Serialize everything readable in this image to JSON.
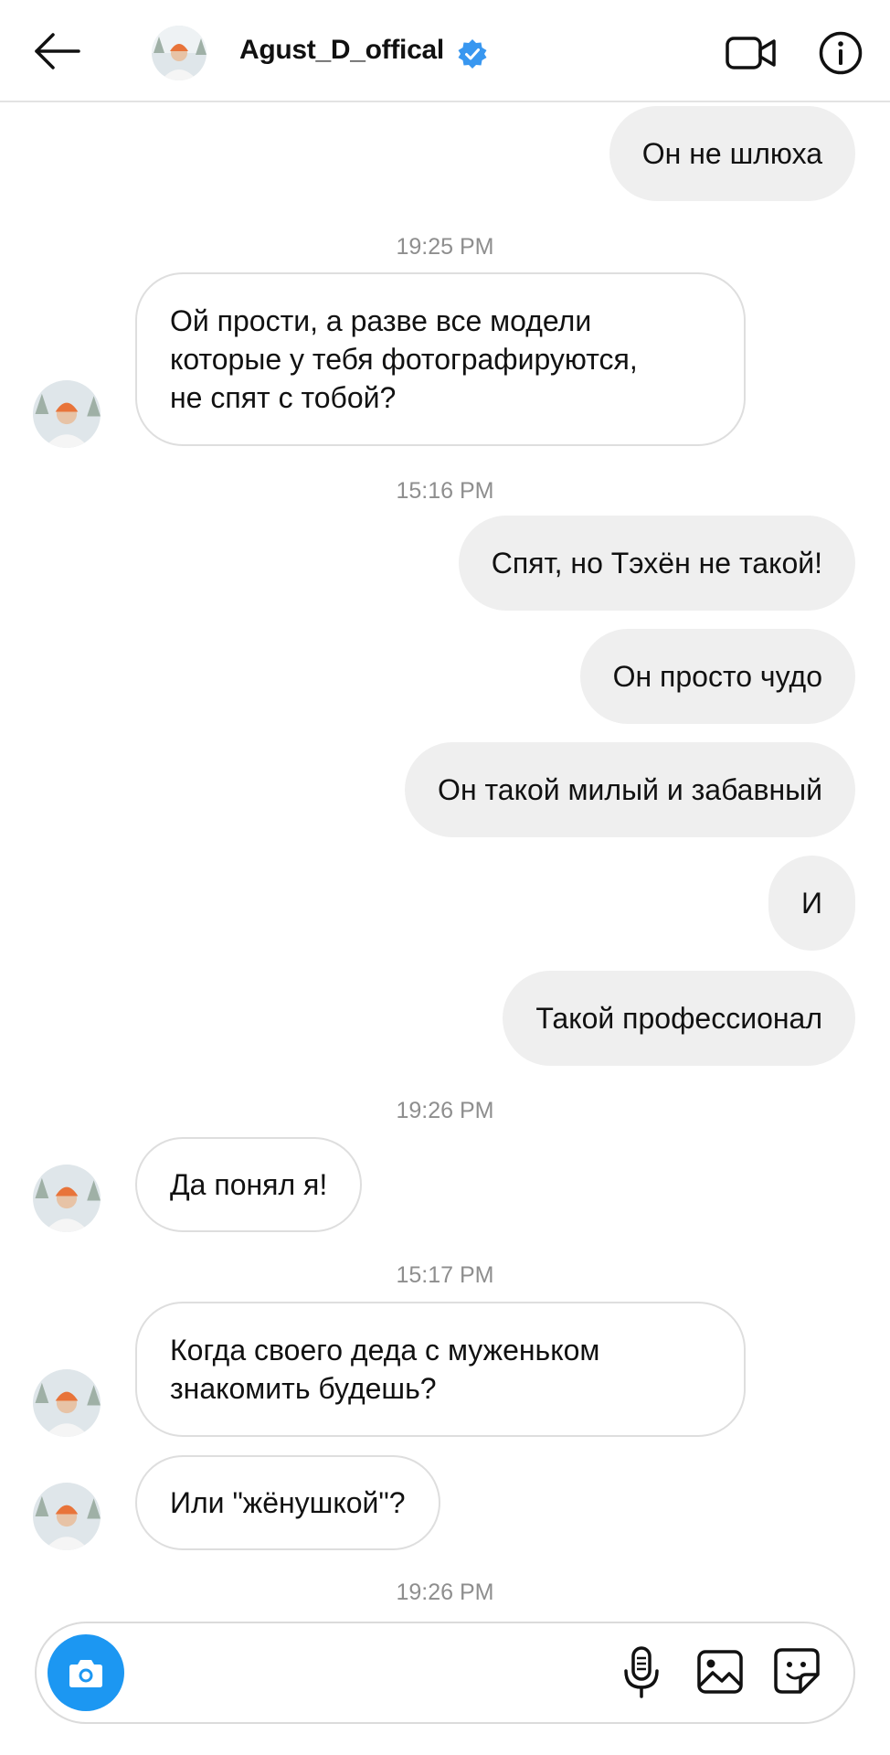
{
  "header": {
    "username": "Agust_D_offical",
    "verified": true,
    "back_icon": "arrow-left-icon",
    "video_icon": "video-camera-icon",
    "info_icon": "info-icon",
    "verified_color": "#3897f0"
  },
  "messages": [
    {
      "type": "outgoing",
      "text": "Он не шлюха"
    },
    {
      "type": "time",
      "text": "19:25 PM"
    },
    {
      "type": "incoming",
      "lines": [
        "Ой прости, а разве все модели",
        "которые у тебя фотографируются,",
        "не спят с тобой?"
      ]
    },
    {
      "type": "time",
      "text": "15:16 PM"
    },
    {
      "type": "outgoing",
      "text": "Спят, но Тэхён не такой!"
    },
    {
      "type": "outgoing",
      "text": "Он просто чудо"
    },
    {
      "type": "outgoing",
      "text": "Он такой милый и забавный"
    },
    {
      "type": "outgoing",
      "text": "И"
    },
    {
      "type": "outgoing",
      "text": "Такой профессионал"
    },
    {
      "type": "time",
      "text": "19:26 PM"
    },
    {
      "type": "incoming",
      "lines": [
        "Да понял я!"
      ]
    },
    {
      "type": "time",
      "text": "15:17 PM"
    },
    {
      "type": "incoming",
      "lines": [
        "Когда своего деда с муженьком",
        "знакомить будешь?"
      ]
    },
    {
      "type": "incoming",
      "lines": [
        "Или \"жёнушкой\"?"
      ]
    },
    {
      "type": "time",
      "text": "19:26 PM"
    }
  ],
  "composer": {
    "value": "",
    "camera_icon": "camera-icon",
    "mic_icon": "microphone-icon",
    "gallery_icon": "image-gallery-icon",
    "sticker_icon": "sticker-icon",
    "camera_color": "#1c97f2"
  },
  "colors": {
    "outgoing_bubble": "#efefef",
    "incoming_border": "#dedede",
    "timestamp": "#8e8e8e"
  }
}
